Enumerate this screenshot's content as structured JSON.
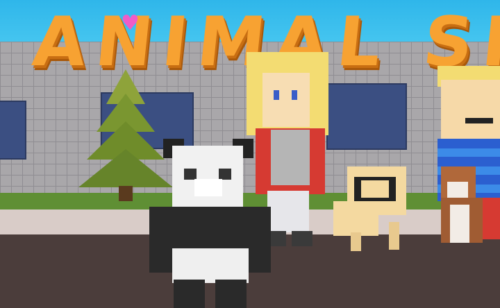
{
  "scene": {
    "sign_text": "ANIMAL SHELT",
    "heart_icon": "heart",
    "colors": {
      "sky": "#3cc2ee",
      "sign": "#f7a232",
      "wall": "#a9a7aa",
      "grass": "#5f8f34",
      "ground": "#4b3d3b"
    }
  }
}
